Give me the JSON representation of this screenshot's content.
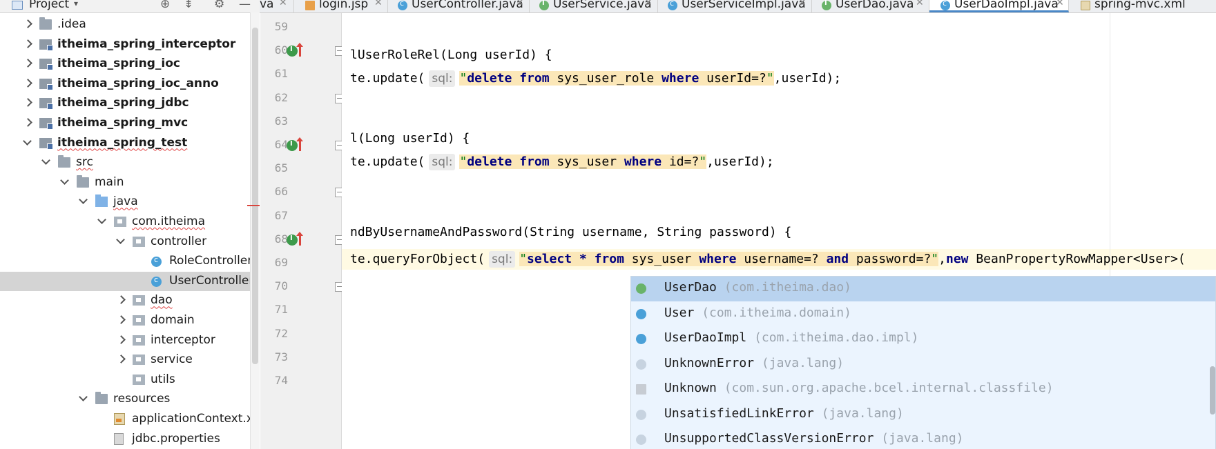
{
  "project_panel": {
    "title": "Project",
    "toolbar_icons": [
      "locate-icon",
      "collapse-icon",
      "gear-icon",
      "minimize-icon"
    ],
    "tree": [
      {
        "label": ".idea",
        "type": "folder",
        "depth": 0,
        "arrow": "right",
        "bold": false
      },
      {
        "label": "itheima_spring_interceptor",
        "type": "module",
        "depth": 0,
        "arrow": "right",
        "bold": true
      },
      {
        "label": "itheima_spring_ioc",
        "type": "module",
        "depth": 0,
        "arrow": "right",
        "bold": true
      },
      {
        "label": "itheima_spring_ioc_anno",
        "type": "module",
        "depth": 0,
        "arrow": "right",
        "bold": true
      },
      {
        "label": "itheima_spring_jdbc",
        "type": "module",
        "depth": 0,
        "arrow": "right",
        "bold": true
      },
      {
        "label": "itheima_spring_mvc",
        "type": "module",
        "depth": 0,
        "arrow": "right",
        "bold": true
      },
      {
        "label": "itheima_spring_test",
        "type": "module",
        "depth": 0,
        "arrow": "down",
        "bold": true
      },
      {
        "label": "src",
        "type": "folder",
        "depth": 1,
        "arrow": "down",
        "bold": false
      },
      {
        "label": "main",
        "type": "folder",
        "depth": 2,
        "arrow": "down",
        "bold": false
      },
      {
        "label": "java",
        "type": "srcfolder",
        "depth": 3,
        "arrow": "down",
        "bold": false
      },
      {
        "label": "com.itheima",
        "type": "pkg",
        "depth": 4,
        "arrow": "down",
        "bold": false
      },
      {
        "label": "controller",
        "type": "pkg",
        "depth": 5,
        "arrow": "down",
        "bold": false
      },
      {
        "label": "RoleController",
        "type": "cls",
        "depth": 6,
        "arrow": "",
        "bold": false
      },
      {
        "label": "UserController",
        "type": "cls",
        "depth": 6,
        "arrow": "",
        "bold": false,
        "selected": true
      },
      {
        "label": "dao",
        "type": "pkg",
        "depth": 5,
        "arrow": "right",
        "bold": false
      },
      {
        "label": "domain",
        "type": "pkg",
        "depth": 5,
        "arrow": "right",
        "bold": false
      },
      {
        "label": "interceptor",
        "type": "pkg",
        "depth": 5,
        "arrow": "right",
        "bold": false
      },
      {
        "label": "service",
        "type": "pkg",
        "depth": 5,
        "arrow": "right",
        "bold": false
      },
      {
        "label": "utils",
        "type": "pkg",
        "depth": 5,
        "arrow": "",
        "bold": false
      },
      {
        "label": "resources",
        "type": "folder",
        "depth": 3,
        "arrow": "down",
        "bold": false
      },
      {
        "label": "applicationContext.xml",
        "type": "xml",
        "depth": 4,
        "arrow": "",
        "bold": false
      },
      {
        "label": "jdbc.properties",
        "type": "props",
        "depth": 4,
        "arrow": "",
        "bold": false
      }
    ]
  },
  "tabs": [
    {
      "label": "va",
      "icon": "",
      "close": true
    },
    {
      "label": "login.jsp",
      "icon": "jsp",
      "close": true
    },
    {
      "label": "UserController.java",
      "icon": "c",
      "close": true
    },
    {
      "label": "UserService.java",
      "icon": "i",
      "close": true
    },
    {
      "label": "UserServiceImpl.java",
      "icon": "c",
      "close": true
    },
    {
      "label": "UserDao.java",
      "icon": "i",
      "close": true
    },
    {
      "label": "UserDaoImpl.java",
      "icon": "c",
      "close": true,
      "active": true
    },
    {
      "label": "spring-mvc.xml",
      "icon": "xml",
      "close": false
    }
  ],
  "editor": {
    "line_numbers": [
      "59",
      "60",
      "61",
      "62",
      "63",
      "64",
      "65",
      "66",
      "67",
      "68",
      "69",
      "70",
      "71",
      "72",
      "73",
      "74"
    ],
    "lines": {
      "l60": "lUserRoleRel(Long userId) {",
      "l61_pre": "te.update(",
      "l61_hint": "sql:",
      "l61_str": [
        "\"",
        "delete ",
        "from ",
        "sys_user_role ",
        "where ",
        "userId=?",
        "\""
      ],
      "l61_post": ",userId);",
      "l64": "l(Long userId) {",
      "l65_pre": "te.update(",
      "l65_hint": "sql:",
      "l65_str": [
        "\"",
        "delete ",
        "from ",
        "sys_user ",
        "where ",
        "id=?",
        "\""
      ],
      "l65_post": ",userId);",
      "l68": "ndByUsernameAndPassword(String username, String password) {",
      "l69_pre": "te.queryForObject(",
      "l69_hint": "sql:",
      "l69_str": [
        "\"",
        "select ",
        "* ",
        "from ",
        "sys_user ",
        "where ",
        "username=? ",
        "and ",
        "password=?",
        "\""
      ],
      "l69_post_kw": "new",
      "l69_post": " BeanPropertyRowMapper<User>("
    }
  },
  "completion": [
    {
      "name": "UserDao",
      "pkg": "(com.itheima.dao)",
      "icon": "i"
    },
    {
      "name": "User",
      "pkg": "(com.itheima.domain)",
      "icon": "c"
    },
    {
      "name": "UserDaoImpl",
      "pkg": "(com.itheima.dao.impl)",
      "icon": "c"
    },
    {
      "name": "UnknownError",
      "pkg": "(java.lang)",
      "icon": "e"
    },
    {
      "name": "Unknown",
      "pkg": "(com.sun.org.apache.bcel.internal.classfile)",
      "icon": "f"
    },
    {
      "name": "UnsatisfiedLinkError",
      "pkg": "(java.lang)",
      "icon": "e"
    },
    {
      "name": "UnsupportedClassVersionError",
      "pkg": "(java.lang)",
      "icon": "e"
    }
  ],
  "colors": {
    "accent": "#4a88c7",
    "selection": "#b9d3ef",
    "string_bg": "#fbe7b8",
    "keyword": "#000080",
    "gutter_marker": "#3d9a4b"
  }
}
